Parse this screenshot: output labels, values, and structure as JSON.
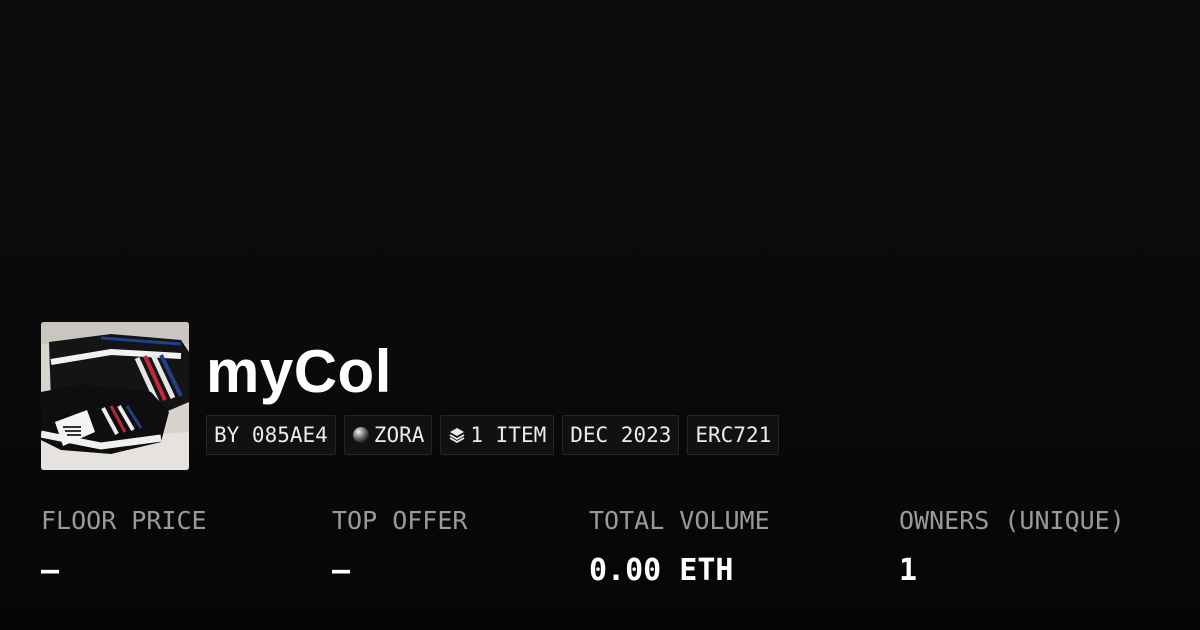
{
  "collection": {
    "name": "myCol",
    "image_alt": "black sneakers in box"
  },
  "tags": {
    "creator": "BY 085AE4",
    "chain": "ZORA",
    "items": "1 ITEM",
    "date": "DEC 2023",
    "standard": "ERC721"
  },
  "stats": [
    {
      "label": "FLOOR PRICE",
      "value": "–"
    },
    {
      "label": "TOP OFFER",
      "value": "–"
    },
    {
      "label": "TOTAL VOLUME",
      "value": "0.00 ETH"
    },
    {
      "label": "OWNERS (UNIQUE)",
      "value": "1"
    }
  ],
  "icons": {
    "chain": "zora-orb-icon",
    "items": "layers-icon"
  },
  "colors": {
    "background": "#0a0a0a",
    "tag_background": "#111111",
    "tag_border": "#262626",
    "label": "#9a9a9a",
    "value": "#ffffff"
  }
}
